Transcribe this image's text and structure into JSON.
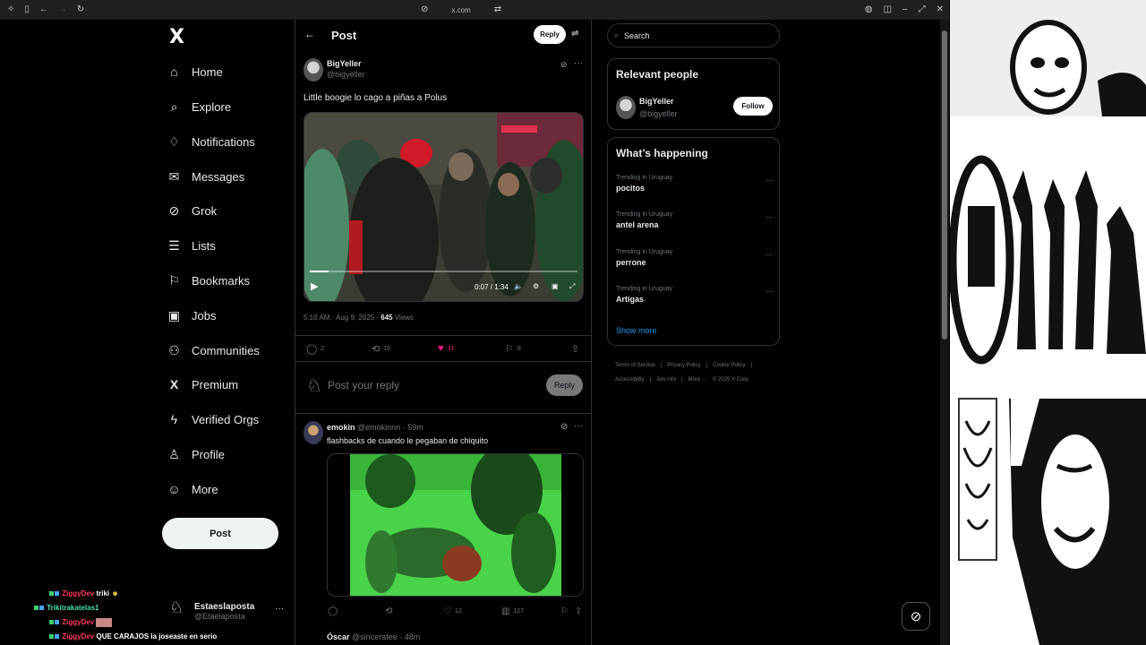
{
  "browser": {
    "url": "x.com"
  },
  "nav": {
    "items": [
      {
        "label": "Home",
        "icon": "home-icon"
      },
      {
        "label": "Explore",
        "icon": "search-icon"
      },
      {
        "label": "Notifications",
        "icon": "bell-icon"
      },
      {
        "label": "Messages",
        "icon": "mail-icon"
      },
      {
        "label": "Grok",
        "icon": "grok-icon"
      },
      {
        "label": "Lists",
        "icon": "list-icon"
      },
      {
        "label": "Bookmarks",
        "icon": "bookmark-icon"
      },
      {
        "label": "Jobs",
        "icon": "briefcase-icon"
      },
      {
        "label": "Communities",
        "icon": "people-icon"
      },
      {
        "label": "Premium",
        "icon": "x-logo-icon"
      },
      {
        "label": "Verified Orgs",
        "icon": "lightning-icon"
      },
      {
        "label": "Profile",
        "icon": "person-icon"
      },
      {
        "label": "More",
        "icon": "more-circle-icon"
      }
    ],
    "post_label": "Post",
    "account": {
      "name": "Estaeslaposta",
      "handle": "@Etaelaposta"
    }
  },
  "header": {
    "title": "Post",
    "reply_label": "Reply"
  },
  "post": {
    "author_name": "BigYeller",
    "author_handle": "@bigyeller",
    "text": "Little boogie lo cago a piñas a Polus",
    "video_time": "0:07 / 1:34",
    "video_progress": 0.07,
    "timestamp": "5:10 AM · Aug 9, 2025 · ",
    "views_count": "645",
    "views_label": " Views",
    "stats": {
      "replies": "2",
      "reposts": "10",
      "likes": "31",
      "bookmarks": "8"
    },
    "like_color": "#f91880"
  },
  "compose": {
    "placeholder": "Post your reply",
    "button": "Reply"
  },
  "reply": {
    "author_name": "emokin",
    "author_meta": "@emokinnn · 59m",
    "text": "flashbacks de cuando le pegaban de chiquito",
    "stats": {
      "likes": "12",
      "views": "127"
    },
    "next_author": "Òscar",
    "next_meta": "@sinceratee · 48m"
  },
  "sidebar": {
    "search_placeholder": "Search",
    "relevant_title": "Relevant people",
    "relevant_name": "BigYeller",
    "relevant_handle": "@bigyeller",
    "follow_label": "Follow",
    "happening_title": "What’s happening",
    "trends": [
      {
        "location": "Trending in Uruguay",
        "topic": "pocitos"
      },
      {
        "location": "Trending in Uruguay",
        "topic": "antel arena"
      },
      {
        "location": "Trending in Uruguay",
        "topic": "perrone"
      },
      {
        "location": "Trending in Uruguay",
        "topic": "Artigas"
      }
    ],
    "show_more": "Show more",
    "footer": [
      "Terms of Service",
      "|",
      "Privacy Policy",
      "|",
      "Cookie Policy",
      "|",
      "Accessibility",
      "|",
      "Ads info",
      "|",
      "More ···",
      "© 2025 X Corp."
    ]
  },
  "chat": [
    {
      "user": "ZiggyDev",
      "msg": "triki",
      "color": "#ff3b5c"
    },
    {
      "user": "Trikitrakatelas1",
      "msg": "",
      "color": "#46e0b0"
    },
    {
      "user": "ZiggyDev",
      "msg": "",
      "color": "#ff3b5c"
    },
    {
      "user": "ZiggyDev",
      "msg": "QUE CARAJOS la joseaste en serio",
      "color": "#ff3b5c"
    }
  ]
}
